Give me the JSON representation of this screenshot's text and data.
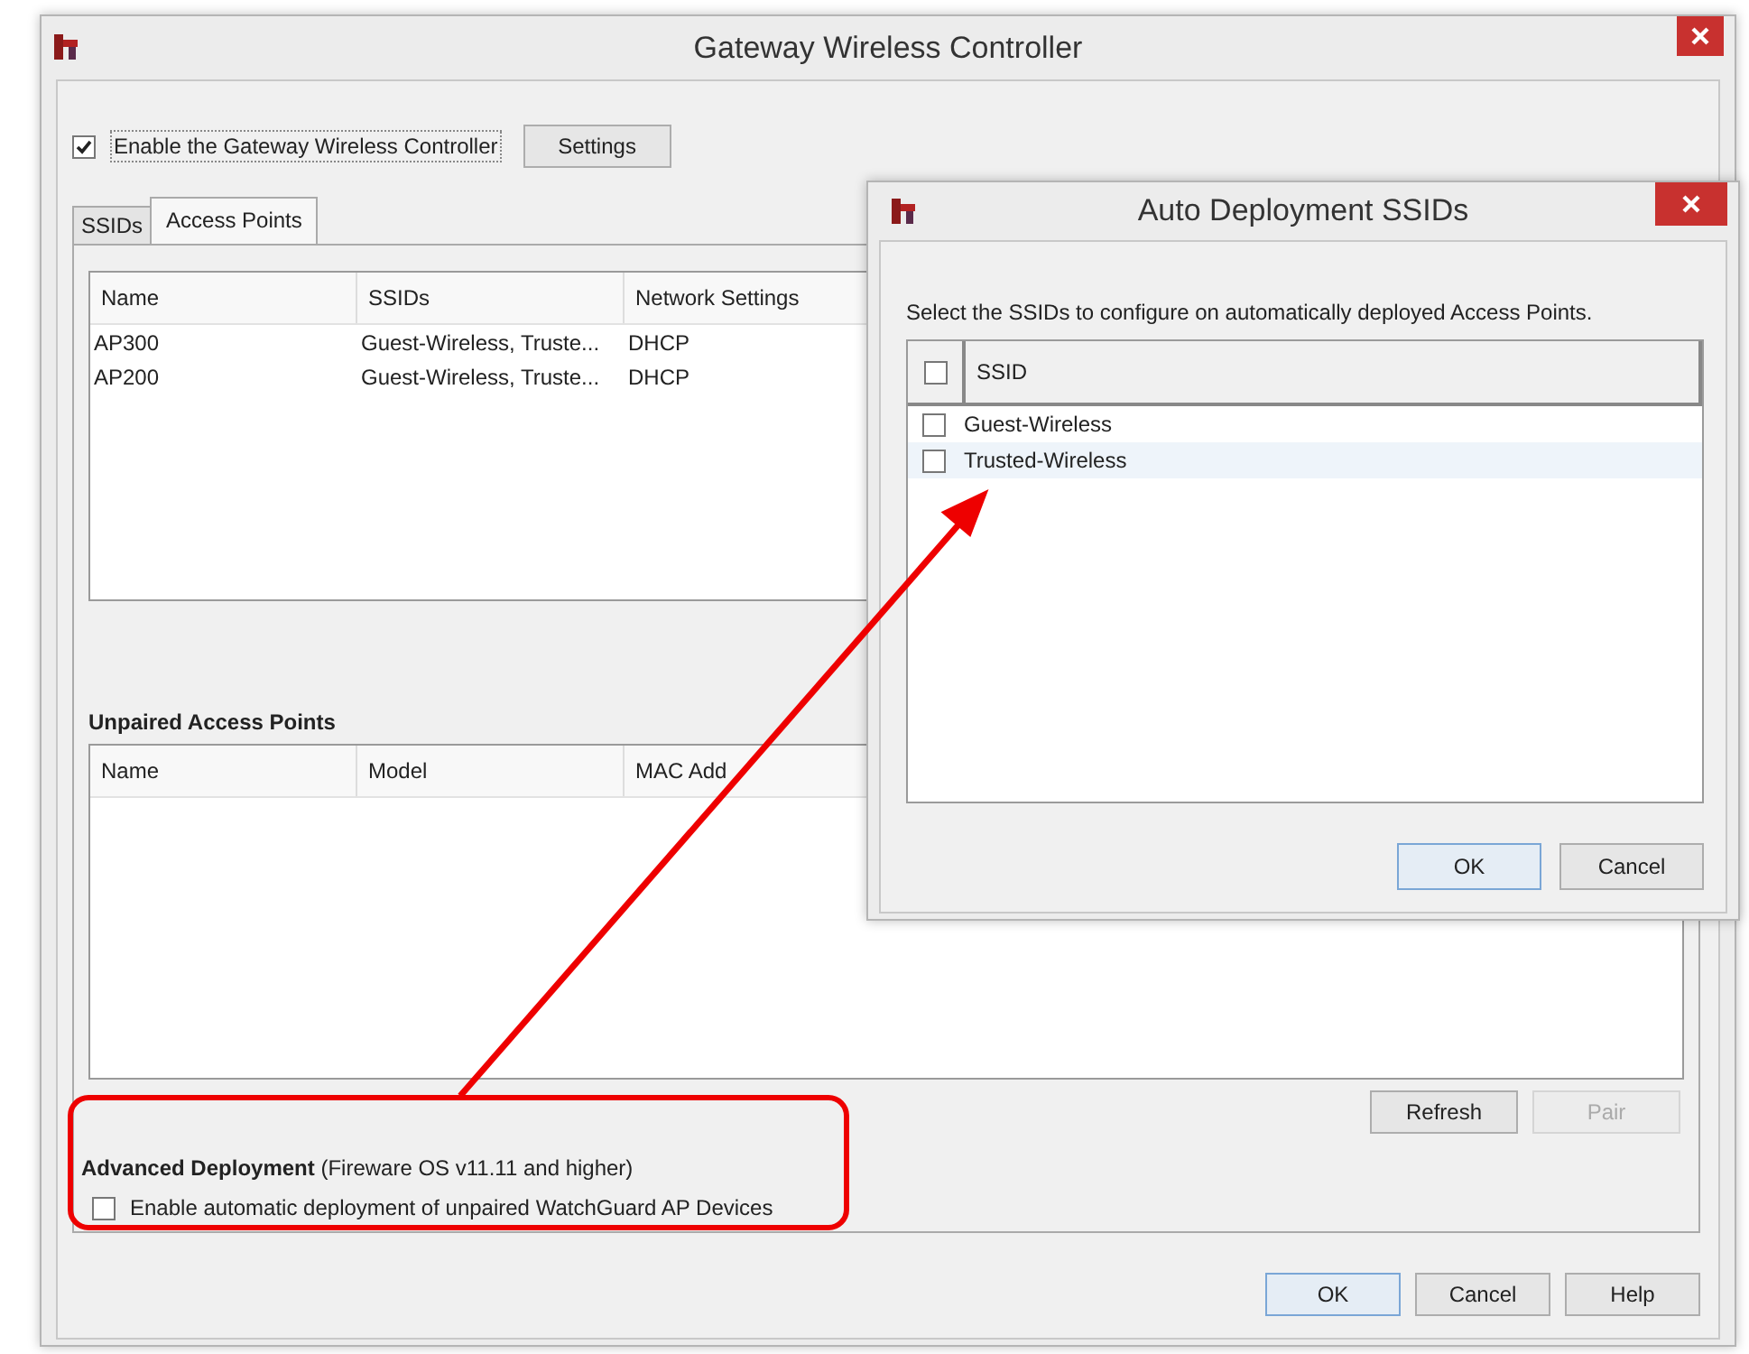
{
  "window": {
    "title": "Gateway Wireless Controller"
  },
  "enable_controller": {
    "label": "Enable the Gateway Wireless Controller",
    "checked": true
  },
  "settings_button": "Settings",
  "tabs": [
    {
      "label": "SSIDs",
      "selected": false
    },
    {
      "label": "Access Points",
      "selected": true
    }
  ],
  "access_points": {
    "columns": [
      "Name",
      "SSIDs",
      "Network Settings"
    ],
    "rows": [
      [
        "AP300",
        "Guest-Wireless, Truste...",
        "DHCP"
      ],
      [
        "AP200",
        "Guest-Wireless, Truste...",
        "DHCP"
      ]
    ]
  },
  "unpaired": {
    "title": "Unpaired Access Points",
    "columns": [
      "Name",
      "Model",
      "MAC Add"
    ]
  },
  "unpaired_buttons": [
    {
      "label": "Refresh",
      "disabled": false
    },
    {
      "label": "Pair",
      "disabled": true
    }
  ],
  "advanced": {
    "title": "**Advanced Deployment** (Fireware OS v11.11 and higher)",
    "option": {
      "label": "Enable automatic deployment of unpaired WatchGuard AP Devices",
      "checked": false
    }
  },
  "buttons": [
    {
      "label": "OK",
      "default": true
    },
    {
      "label": "Cancel",
      "default": false
    },
    {
      "label": "Help",
      "default": false
    }
  ],
  "dialog": {
    "title": "Auto Deployment SSIDs",
    "instruction": "Select the SSIDs to configure on automatically deployed Access Points.",
    "header_checked": false,
    "column": "SSID",
    "rows": [
      {
        "label": "Guest-Wireless",
        "checked": false,
        "selected": false
      },
      {
        "label": "Trusted-Wireless",
        "checked": false,
        "selected": true
      }
    ],
    "buttons": [
      {
        "label": "OK",
        "default": true
      },
      {
        "label": "Cancel",
        "default": false
      }
    ]
  }
}
